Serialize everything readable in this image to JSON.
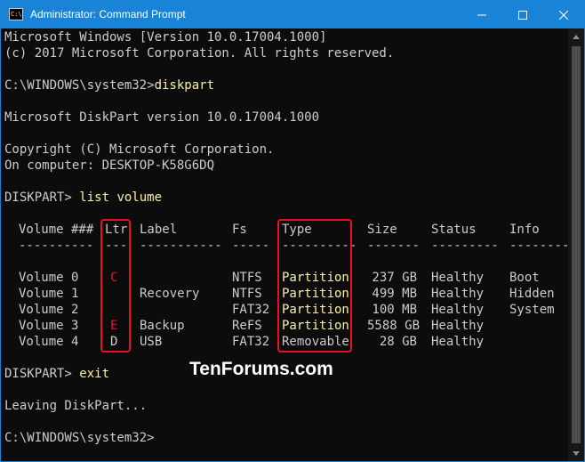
{
  "window": {
    "title": "Administrator: Command Prompt",
    "icon_glyph": "C:\\",
    "accent_color": "#1883d7"
  },
  "console": {
    "lines": [
      "Microsoft Windows [Version 10.0.17004.1000]",
      "(c) 2017 Microsoft Corporation. All rights reserved.",
      "C:\\WINDOWS\\system32>",
      "Microsoft DiskPart version 10.0.17004.1000",
      "Copyright (C) Microsoft Corporation.",
      "On computer: DESKTOP-K58G6DQ",
      "DISKPART> ",
      "DISKPART> ",
      "Leaving DiskPart...",
      "C:\\WINDOWS\\system32>"
    ],
    "commands": [
      "diskpart",
      "list volume",
      "exit"
    ],
    "table": {
      "headers": [
        "Volume ###",
        "Ltr",
        "Label",
        "Fs",
        "Type",
        "Size",
        "Status",
        "Info"
      ],
      "separators": [
        "----------",
        "---",
        "-----------",
        "-----",
        "----------",
        "-------",
        "---------",
        "--------"
      ],
      "rows": [
        [
          "Volume 0",
          "C",
          "",
          "NTFS",
          "Partition",
          "237 GB",
          "Healthy",
          "Boot"
        ],
        [
          "Volume 1",
          "",
          "Recovery",
          "NTFS",
          "Partition",
          "499 MB",
          "Healthy",
          "Hidden"
        ],
        [
          "Volume 2",
          "",
          "",
          "FAT32",
          "Partition",
          "100 MB",
          "Healthy",
          "System"
        ],
        [
          "Volume 3",
          "E",
          "Backup",
          "ReFS",
          "Partition",
          "5588 GB",
          "Healthy",
          ""
        ],
        [
          "Volume 4",
          "D",
          "USB",
          "FAT32",
          "Removable",
          "28 GB",
          "Healthy",
          ""
        ]
      ]
    }
  },
  "watermark": "TenForums.com",
  "colors": {
    "text": "#cccccc",
    "command": "#f9f1a5",
    "highlight": "#e81123",
    "background": "#0c0c0c"
  }
}
